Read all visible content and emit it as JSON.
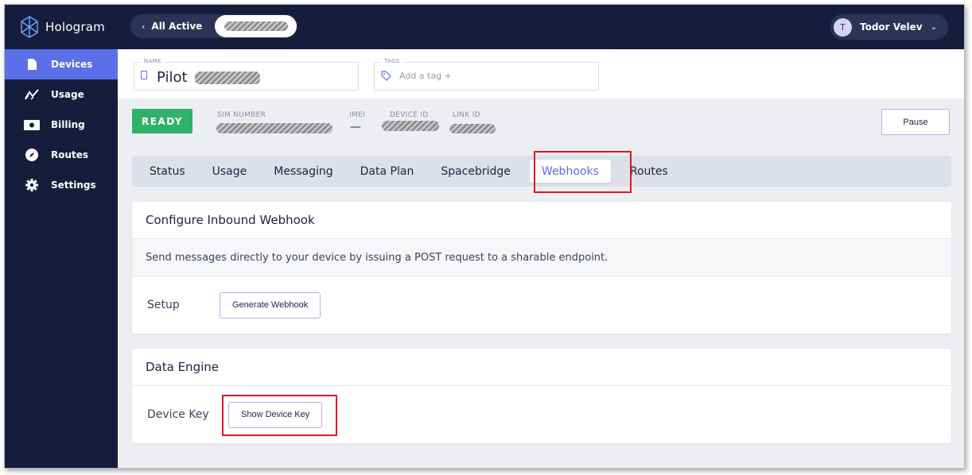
{
  "app": {
    "name": "Hologram"
  },
  "sidebar": {
    "items": [
      {
        "label": "Devices",
        "icon": "device-icon",
        "active": true
      },
      {
        "label": "Usage",
        "icon": "usage-chart-icon",
        "active": false
      },
      {
        "label": "Billing",
        "icon": "billing-card-icon",
        "active": false
      },
      {
        "label": "Routes",
        "icon": "routes-compass-icon",
        "active": false
      },
      {
        "label": "Settings",
        "icon": "gear-icon",
        "active": false
      }
    ]
  },
  "header": {
    "breadcrumb_label": "All Active",
    "user": {
      "initial": "T",
      "name": "Todor Velev"
    }
  },
  "device": {
    "name_label": "NAME",
    "name_value": "Pilot",
    "tags_label": "TAGS",
    "tags_placeholder": "Add a tag +",
    "status": "READY",
    "sim_label": "SIM NUMBER",
    "imei_label": "IMEI",
    "imei_value": "—",
    "device_id_label": "DEVICE ID",
    "link_id_label": "LINK ID",
    "pause_label": "Pause"
  },
  "tabs": [
    {
      "label": "Status",
      "active": false
    },
    {
      "label": "Usage",
      "active": false
    },
    {
      "label": "Messaging",
      "active": false
    },
    {
      "label": "Data Plan",
      "active": false
    },
    {
      "label": "Spacebridge",
      "active": false
    },
    {
      "label": "Webhooks",
      "active": true
    },
    {
      "label": "Routes",
      "active": false
    }
  ],
  "webhook_card": {
    "title": "Configure Inbound Webhook",
    "description": "Send messages directly to your device by issuing a POST request to a sharable endpoint.",
    "setup_label": "Setup",
    "button_label": "Generate Webhook"
  },
  "data_engine_card": {
    "title": "Data Engine",
    "key_label": "Device Key",
    "button_label": "Show Device Key"
  },
  "colors": {
    "sidebar_bg": "#161d3c",
    "accent": "#5a6fe8",
    "ready_green": "#2fb36a",
    "highlight_red": "#e0181f"
  }
}
